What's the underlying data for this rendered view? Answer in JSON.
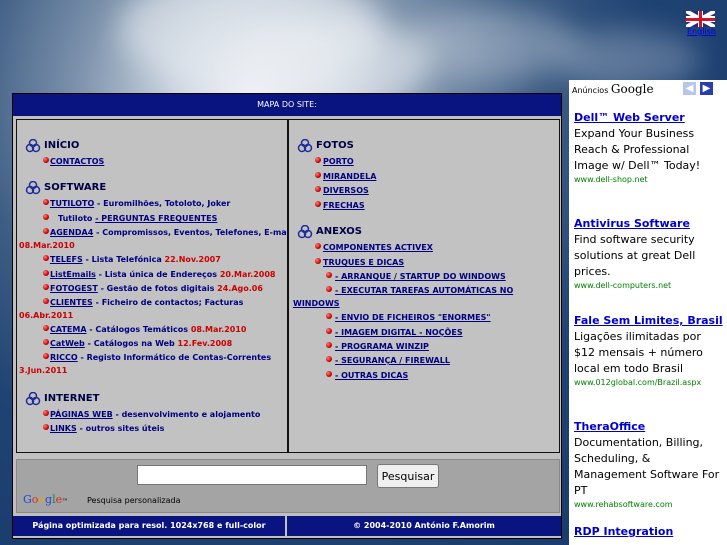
{
  "lang_link": "English",
  "mapa_title": "MAPA DO SITE:",
  "left": {
    "inicio": {
      "title": "INÍCIO",
      "items": [
        {
          "link": "CONTACTOS",
          "desc": ""
        }
      ]
    },
    "software": {
      "title": "SOFTWARE",
      "tutiloto": {
        "link": "TUTILOTO",
        "desc": " - Euromilhões, Totoloto, Joker"
      },
      "tutiloto_faq": {
        "prefix": "Tutiloto ",
        "link": "- PERGUNTAS FREQUENTES"
      },
      "agenda4": {
        "link": "AGENDA4",
        "desc": " - Compromissos, Eventos, Telefones, E-mails",
        "date": "08.Mar.2010"
      },
      "telefs": {
        "link": "TELEFS",
        "desc": " - Lista Telefónica ",
        "date": "22.Nov.2007"
      },
      "listemails": {
        "link": "ListEmails",
        "desc": " - Lista única de Endereços ",
        "date": "20.Mar.2008"
      },
      "fotogest": {
        "link": "FOTOGEST",
        "desc": " - Gestão de fotos digitais ",
        "date": "24.Ago.06"
      },
      "clientes": {
        "link": "CLIENTES",
        "desc": " - Ficheiro de contactos; Facturas",
        "date": "06.Abr.2011"
      },
      "catema": {
        "link": "CATEMA",
        "desc": " - Catálogos Temáticos ",
        "date": "08.Mar.2010"
      },
      "catweb": {
        "link": "CatWeb",
        "desc": " - Catálogos na Web ",
        "date": "12.Fev.2008"
      },
      "ricco": {
        "link": "RICCO",
        "desc": " - Registo Informático de Contas-Correntes",
        "date": "3.Jun.2011"
      }
    },
    "internet": {
      "title": "INTERNET",
      "paginas": {
        "link": "PÁGINAS WEB",
        "desc": " - desenvolvimento e alojamento"
      },
      "links": {
        "link": "LINKS",
        "desc": " - outros sites úteis"
      }
    }
  },
  "right": {
    "fotos": {
      "title": "FOTOS",
      "items": [
        "PORTO",
        "MIRANDELA",
        "DIVERSOS",
        "FRECHAS"
      ]
    },
    "anexos": {
      "title": "ANEXOS",
      "items": [
        "COMPONENTES ACTIVEX",
        "TRUQUES E DICAS"
      ],
      "sub": {
        "arranque": "- ARRANQUE / STARTUP DO WINDOWS",
        "executar_a": "- EXECUTAR TAREFAS AUTOMÁTICAS NO",
        "executar_b": "WINDOWS",
        "envio": "- ENVIO DE FICHEIROS \"ENORMES\"",
        "imagem": "- IMAGEM DIGITAL - NOÇÕES",
        "winzip": "- PROGRAMA WINZIP",
        "seguranca": "- SEGURANÇA / FIREWALL",
        "outras": "- OUTRAS DICAS"
      }
    }
  },
  "search": {
    "button": "Pesquisar",
    "google_caption": "Pesquisa personalizada",
    "value": ""
  },
  "footer": {
    "left": "Página optimizada para resol. 1024x768 e full-color",
    "right": "© 2004-2010 António F.Amorim"
  },
  "ads": {
    "header_label": "Anúncios",
    "header_google": "Google",
    "items": [
      {
        "title": "Dell™ Web Server",
        "desc": "Expand Your Business Reach & Professional Image w/ Dell™ Today!",
        "url": "www.dell-shop.net"
      },
      {
        "title": "Antivirus Software",
        "desc": "Find software security solutions at great Dell prices.",
        "url": "www.dell-computers.net"
      },
      {
        "title": "Fale Sem Limites, Brasil",
        "desc": "Ligações ilimitadas por $12 mensais + número local em todo Brasil",
        "url": "www.012global.com/Brazil.aspx"
      },
      {
        "title": "TheraOffice",
        "desc": "Documentation, Billing, Scheduling, & Management Software For PT",
        "url": "www.rehabsoftware.com"
      },
      {
        "title": "RDP Integration",
        "desc": "",
        "url": ""
      }
    ]
  },
  "colors": {
    "header_bg": "#0a1480",
    "link": "#000080",
    "date_red": "#cc0000",
    "ad_title": "#0000cc",
    "ad_url": "#008000"
  }
}
